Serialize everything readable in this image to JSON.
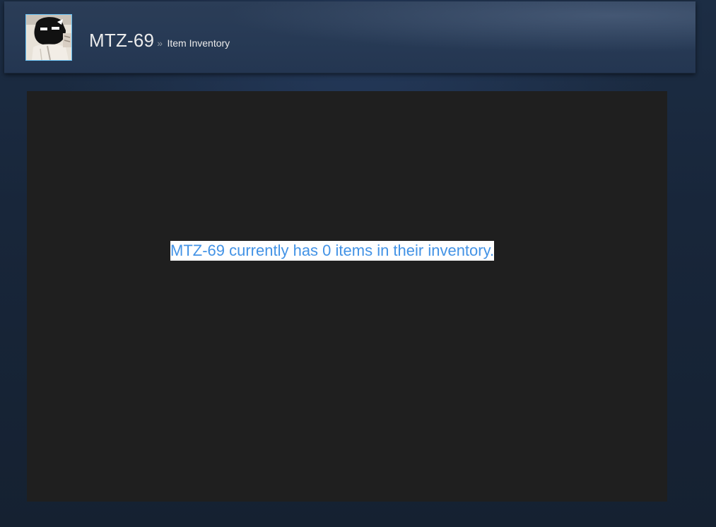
{
  "profile": {
    "persona_name": "MTZ-69",
    "breadcrumb_separator": "»",
    "section_label": "Item Inventory",
    "avatar_icon": "masked-person-avatar"
  },
  "inventory": {
    "empty_message": "MTZ-69 currently has 0 items in their inventory."
  },
  "colors": {
    "accent": "#66c0f4",
    "message_text": "#4393e6",
    "panel_bg": "#1f1f1f",
    "page_bg": "#1b2838"
  }
}
